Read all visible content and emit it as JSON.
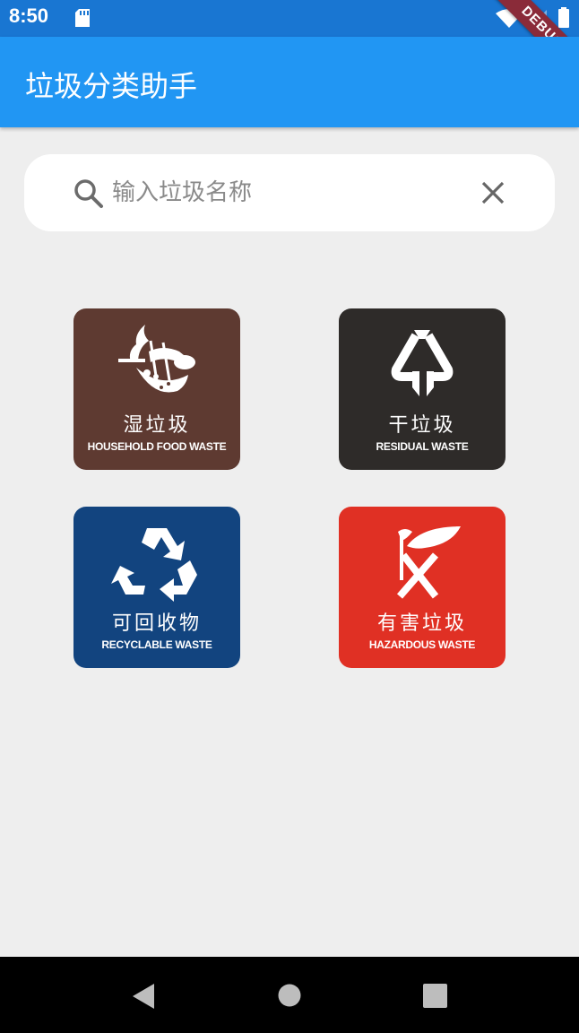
{
  "status_bar": {
    "time": "8:50",
    "icons": [
      "sd-card-icon",
      "wifi-icon",
      "signal-icon",
      "battery-icon"
    ]
  },
  "debug_banner": "DEBUG",
  "app_bar": {
    "title": "垃圾分类助手"
  },
  "search": {
    "placeholder": "输入垃圾名称",
    "value": "",
    "leading_icon": "search-icon",
    "trailing_icon": "close-icon"
  },
  "categories": [
    {
      "label_cn": "湿垃圾",
      "label_en": "HOUSEHOLD FOOD WASTE",
      "color": "#5e3a31",
      "icon": "fish-bone-icon"
    },
    {
      "label_cn": "干垃圾",
      "label_en": "RESIDUAL WASTE",
      "color": "#2e2b29",
      "icon": "residual-triangle-icon"
    },
    {
      "label_cn": "可回收物",
      "label_en": "RECYCLABLE WASTE",
      "color": "#12447f",
      "icon": "recycle-icon"
    },
    {
      "label_cn": "有害垃圾",
      "label_en": "HAZARDOUS WASTE",
      "color": "#e03024",
      "icon": "hazardous-icon"
    }
  ],
  "colors": {
    "app_bar": "#2196f3",
    "status_bar": "#1976d2",
    "background": "#eeeeee"
  },
  "nav_bar": {
    "icons": [
      "back-icon",
      "home-icon",
      "recents-icon"
    ]
  }
}
